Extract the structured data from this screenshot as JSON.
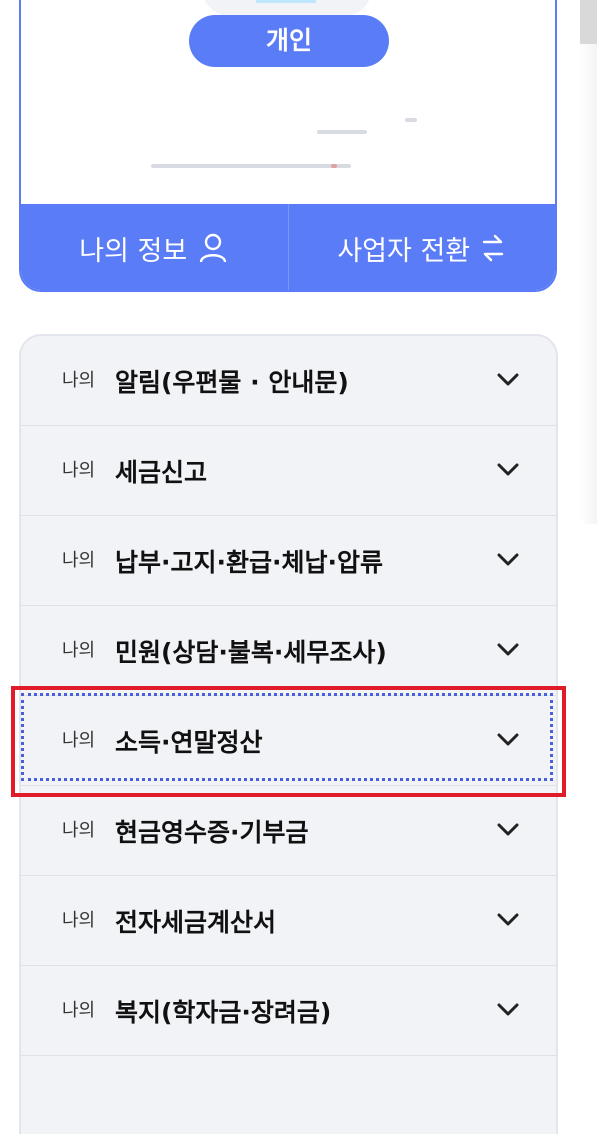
{
  "profile": {
    "user_type_badge": "개인",
    "actions": [
      {
        "label": "나의 정보",
        "icon": "person-icon"
      },
      {
        "label": "사업자 전환",
        "icon": "swap-arrows-icon"
      }
    ]
  },
  "menu": {
    "items": [
      {
        "prefix": "나의",
        "title": "알림(우편물 · 안내문)"
      },
      {
        "prefix": "나의",
        "title": "세금신고"
      },
      {
        "prefix": "나의",
        "title": "납부·고지·환급·체납·압류"
      },
      {
        "prefix": "나의",
        "title": "민원(상담·불복·세무조사)"
      },
      {
        "prefix": "나의",
        "title": "소득·연말정산"
      },
      {
        "prefix": "나의",
        "title": "현금영수증·기부금"
      },
      {
        "prefix": "나의",
        "title": "전자세금계산서"
      },
      {
        "prefix": "나의",
        "title": "복지(학자금·장려금)"
      }
    ],
    "focused_index": 4
  },
  "colors": {
    "accent": "#5b7cf7",
    "menu_bg": "#f2f3f7",
    "highlight": "#e01b2a",
    "focus_ring": "#4a5fd9"
  }
}
